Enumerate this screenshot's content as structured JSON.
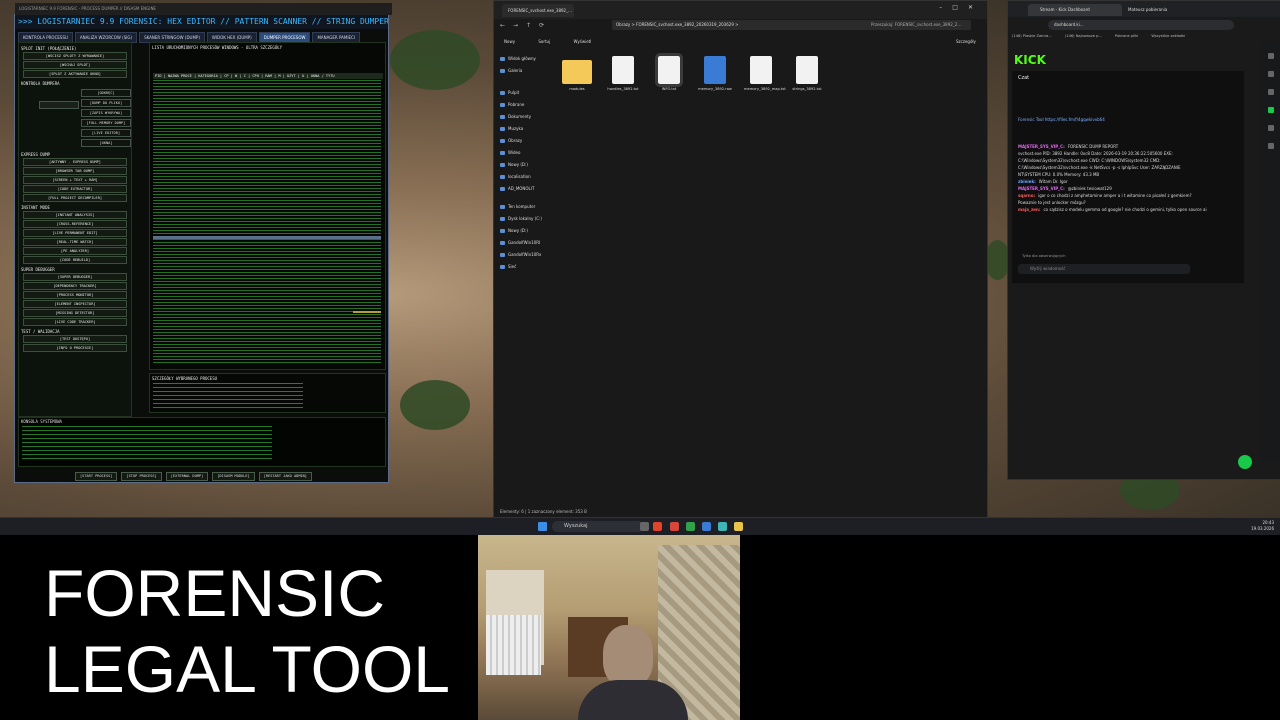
{
  "hexeditor": {
    "window_title": "LOGISTARNIEC 9.9 FORENSIC - PROCESS DUMPER // DISASM ENGINE",
    "title": ">>> LOGISTARNIEC 9.9 FORENSIC: HEX EDITOR // PATTERN SCANNER // STRING DUMPER // EX",
    "tabs": [
      "KONTROLA PROCESSU",
      "ANALIZA WZORCOW (SIG)",
      "SKANER STRINGOW (DUMP)",
      "WIDOK HEX (DUMP)",
      "DUMPER PROCESOW",
      "MANAGER PAMIECI"
    ],
    "sidebar_sections": [
      {
        "label": "SPLOT INIT (POŁĄCZENIE)",
        "buttons": [
          "[WSCISZ SPLOTY Z WYRAWANIE]",
          "[WSCHAJ SPLOT]",
          "[SPLOT Z AKTYWANIE OKNO]"
        ]
      },
      {
        "label": "KONTROLA DUMPERA",
        "buttons": [
          "[ODKRĘĆ]",
          "[DUMP DO PLIKU]",
          "[ZAPIS WYKRYWA]",
          "[FULL MEMORY DUMP]",
          "[LIVE EDITOR]",
          "[OKNA]"
        ]
      },
      {
        "label": "EXPRESS DUMP",
        "buttons": [
          "[AKTYWNY - EXPRESS DUMP]",
          "[BROWSER TAB DUMP]",
          "[SCREEN + TEXT + RAM]",
          "[CODE EXTRACTOR]",
          "[FULL PROJECT DECOMPILER]"
        ]
      },
      {
        "label": "INSTANT MODE",
        "buttons": [
          "[INSTANT ANALYSIS]",
          "[CROSS-REFERENCE]",
          "[LIVE PERMANENT EDIT]",
          "[REAL-TIME WATCH]",
          "[PE ANALYZER]",
          "[CODE REBUILD]"
        ]
      },
      {
        "label": "SUPER DEBUGGER",
        "buttons": [
          "[SUPER DEBUGGER]",
          "[DEPENDENCY TRACKER]",
          "[PROCESS MONITOR]",
          "[ELEMENT INSPECTOR]",
          "[MISSING DETECTOR]",
          "[LIVE CODE TRACKER]"
        ]
      },
      {
        "label": "TEST / WALIDACJA",
        "buttons": [
          "[TEST DOSTĘPU]",
          "[INFO O PROCESIE]"
        ]
      }
    ],
    "process_list_title": "LISTA URUCHOMIONYCH PROCESÓW WINDOWS - ULTRA SZCZEGÓŁY",
    "columns": "PID | NAZWA PROCE | KATEGORIA | CP | W | C | CPU | RAM | M | UŻYT | U | OKNA / TYTU",
    "details_label": "SZCZEGÓŁY WYBRANEGO PROCESU",
    "console_label": "KONSOLA SYSTEMOWA",
    "bottom_buttons": [
      "[START PROCESS]",
      "[STOP PROCESS]",
      "[EXTERNAL DUMP]",
      "[DISASM MODULE]",
      "[RESTART JAKO ADMIN]"
    ]
  },
  "explorer": {
    "tab_label": "FORENSIC_svchost.exe_3892_...",
    "address": "Obrazy  >  FORENSIC_svchost.exe_3892_20260319_203629  >",
    "search_placeholder": "Przeszukaj: FORENSIC_svchost.exe_3892_2...",
    "toolbar": [
      "Nowy",
      "Sortuj",
      "Wyświetl",
      "Szczegóły"
    ],
    "nav_items": [
      "Widok główny",
      "Galeria",
      "Pulpit",
      "Pobrane",
      "Dokumenty",
      "Muzyka",
      "Obrazy",
      "Wideo",
      "Nowy (D:)",
      "localisation",
      "AD_MONOLIT",
      "Ten komputer",
      "Dysk lokalny (C:)",
      "Nowy (D:)",
      "GandolfWin10RI",
      "GandolfWin10Rx",
      "Sieć"
    ],
    "files": [
      {
        "name": "modules",
        "type": "folder"
      },
      {
        "name": "handles_3892.txt",
        "type": "text"
      },
      {
        "name": "INFO.txt",
        "type": "text"
      },
      {
        "name": "memory_3892.raw",
        "type": "image"
      },
      {
        "name": "memory_3892_map.txt",
        "type": "text"
      },
      {
        "name": "strings_3892.txt",
        "type": "text"
      }
    ],
    "status": "Elementy: 6   |   1 zaznaczony element: 353 B"
  },
  "browser": {
    "tabs": [
      "Stream - Kick Dashboard",
      "Mateusz pobierania"
    ],
    "url": "dashboard.ki...",
    "bookmarks": [
      "(146) Plaskie Zamra...",
      "(146) Najnowsze p...",
      "Pobrane pliki",
      "Wszystkie zakładki"
    ],
    "logo": "KICK",
    "chat_header": "Czat",
    "pinned": "Forensic Tool https://files.fm/f/4gqwkivxb64",
    "chat": [
      {
        "user": "MAJSTER_SYS_VIP_C:",
        "color": "#e36af0",
        "text": "FORENSIC DUMP REPORT"
      },
      {
        "user": "",
        "color": "#ddd",
        "text": "svchost.exe PID: 3892 Handle: 0xc8 Date: 2026-03-19 20:36:22.505600 EXE:"
      },
      {
        "user": "",
        "color": "#ddd",
        "text": "C:\\Windows\\System32\\svchost.exe CWD: C:\\WINDOWS\\system32 CMD:"
      },
      {
        "user": "",
        "color": "#ddd",
        "text": "C:\\Windows\\System32\\svchost.exe -k NetSvcs -p -s IphlpSvc User: ZARZĄDZANIE"
      },
      {
        "user": "",
        "color": "#ddd",
        "text": "NT\\SYSTEM CPU: 0.0% Memory: 43.3 MB"
      },
      {
        "user": "zbiniek:",
        "color": "#6aa8ff",
        "text": "Witam Dr. Igor"
      },
      {
        "user": "MAJSTER_SYS_VIP_C:",
        "color": "#e36af0",
        "text": "@zbiniek tesiowat129"
      },
      {
        "user": "sqarno:",
        "color": "#ff5c5c",
        "text": "igor o co chodzi z amphetamine amper a i t witamine co pisałeś z gemkiem?"
      },
      {
        "user": "",
        "color": "#ddd",
        "text": "Powaznie to jest unlocker mózgu?"
      },
      {
        "user": "maja_zen:",
        "color": "#ff5c5c",
        "text": "co sądzisz o modelu gemma od google? nie chodzi o gemini, tylko open source ai"
      }
    ],
    "chat_mode": "Tylko dla obserwujących",
    "chat_input_placeholder": "Wyślij wiadomość"
  },
  "taskbar": {
    "search": "Wyszukaj",
    "time": "20:43",
    "date": "19.03.2026"
  },
  "overlay": {
    "title_line1": "FORENSIC",
    "title_line2": "LEGAL TOOL"
  }
}
